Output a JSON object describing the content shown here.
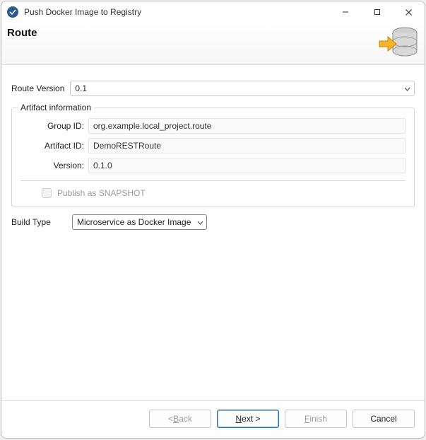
{
  "window": {
    "title": "Push Docker Image to Registry"
  },
  "banner": {
    "heading": "Route"
  },
  "routeVersion": {
    "label": "Route Version",
    "value": "0.1"
  },
  "artifact": {
    "legend": "Artifact information",
    "groupIdLabel": "Group ID:",
    "groupId": "org.example.local_project.route",
    "artifactIdLabel": "Artifact ID:",
    "artifactId": "DemoRESTRoute",
    "versionLabel": "Version:",
    "version": "0.1.0",
    "publishSnapshotLabel": "Publish as SNAPSHOT"
  },
  "buildType": {
    "label": "Build Type",
    "value": "Microservice as Docker Image"
  },
  "buttons": {
    "back": {
      "pre": "< ",
      "m": "B",
      "post": "ack"
    },
    "next": {
      "pre": "",
      "m": "N",
      "post": "ext >"
    },
    "finish": {
      "pre": "",
      "m": "F",
      "post": "inish"
    },
    "cancel": "Cancel"
  }
}
